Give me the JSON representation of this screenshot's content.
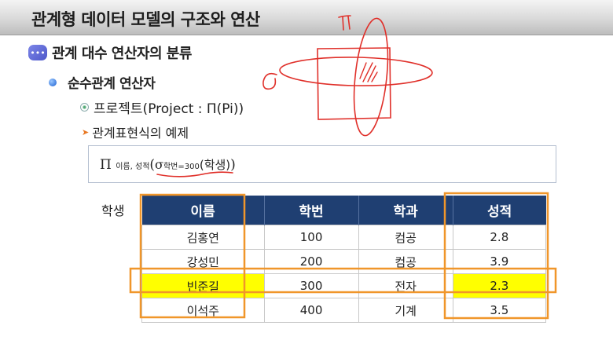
{
  "header": {
    "title": "관계형 데이터 모델의 구조와 연산"
  },
  "outline": {
    "level1": "관계 대수 연산자의 분류",
    "level2": "순수관계 연산자",
    "level3": "프로젝트(Project : Π(Pi))",
    "level4": "관계표현식의 예제"
  },
  "expression": {
    "pi": "Π",
    "projection_attrs": "이름, 성적",
    "open_paren": "(",
    "sigma": "σ",
    "condition": "학번=300",
    "relation": "(학생)",
    "close_paren": ")"
  },
  "table": {
    "label": "학생",
    "columns": [
      "이름",
      "학번",
      "학과",
      "성적"
    ],
    "rows": [
      [
        "김홍연",
        "100",
        "컴공",
        "2.8"
      ],
      [
        "강성민",
        "200",
        "컴공",
        "3.9"
      ],
      [
        "빈준길",
        "300",
        "전자",
        "2.3"
      ],
      [
        "이석주",
        "400",
        "기계",
        "3.5"
      ]
    ],
    "highlight_row": 2,
    "highlight_color": "#ffff00",
    "header_color": "#1f3f72"
  },
  "annotations": {
    "pen_color": "#e0302a",
    "box_color": "#f0962a",
    "pi_mark": "π",
    "sigma_mark": "σ"
  }
}
